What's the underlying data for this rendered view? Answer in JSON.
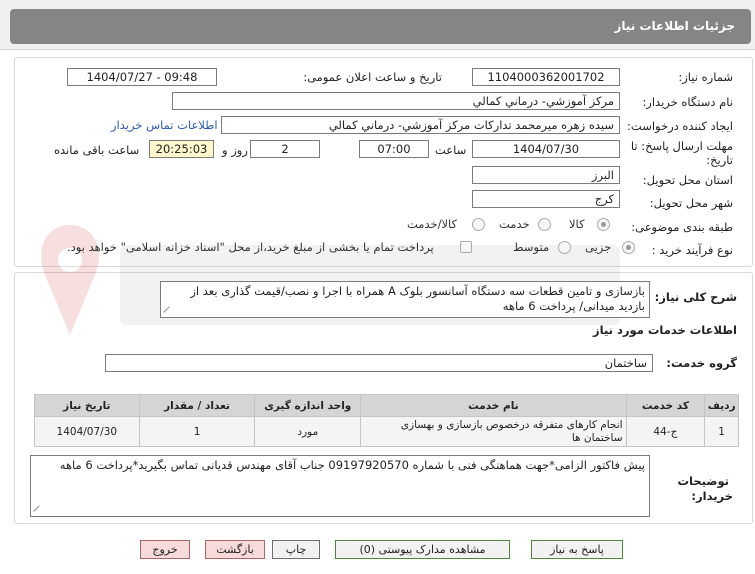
{
  "header": {
    "title": "جزئیات اطلاعات نیاز"
  },
  "form": {
    "need_number_label": "شماره نیاز:",
    "need_number": "1104000362001702",
    "announce_label": "تاریخ و ساعت اعلان عمومی:",
    "announce_value": "1404/07/27 - 09:48",
    "buyer_label": "نام دستگاه خریدار:",
    "buyer_value": "مرکز آموزشي- درماني كمالي",
    "creator_label": "ایجاد کننده درخواست:",
    "creator_value": "سیده زهره میرمحمد تدارکات مرکز آموزشي- درماني كمالي",
    "contact_link": "اطلاعات تماس خریدار",
    "deadline_label_1": "مهلت ارسال پاسخ: تا",
    "deadline_label_2": "تاریخ:",
    "deadline_date": "1404/07/30",
    "time_label": "ساعت",
    "deadline_time": "07:00",
    "days_value": "2",
    "days_label": "روز و",
    "remaining_time": "20:25:03",
    "remaining_label": "ساعت باقی مانده",
    "province_label": "استان محل تحویل:",
    "province_value": "البرز",
    "city_label": "شهر محل تحویل:",
    "city_value": "کرج",
    "category_label": "طبقه بندی موضوعی:",
    "category_options": [
      "کالا",
      "خدمت",
      "کالا/خدمت"
    ],
    "process_label": "نوع فرآیند خرید :",
    "process_options": [
      "جزیی",
      "متوسط"
    ],
    "payment_note": "پرداخت تمام یا بخشی از مبلغ خرید،از محل \"اسناد خزانه اسلامی\" خواهد بود."
  },
  "details": {
    "summary_label": "شرح کلی نیاز:",
    "summary_text": "بازسازی و تامین قطعات سه دستگاه آسانسور بلوک A همراه با اجرا و نصب/قیمت گذاری بعد از بازدید میدانی/ پرداخت 6 ماهه",
    "services_title": "اطلاعات خدمات مورد نیاز",
    "group_label": "گروه خدمت:",
    "group_value": "ساختمان",
    "table": {
      "headers": [
        "ردیف",
        "کد خدمت",
        "نام خدمت",
        "واحد اندازه گیری",
        "تعداد / مقدار",
        "تاریخ نیاز"
      ],
      "rows": [
        [
          "1",
          "ج-44",
          "انجام کارهای متفرقه درخصوص بازسازی و بهسازی ساختمان ها",
          "مورد",
          "1",
          "1404/07/30"
        ]
      ]
    },
    "notes_label_1": "توضیحات",
    "notes_label_2": "خریدار:",
    "notes_text": "پیش فاکتور الزامی*جهت هماهنگی فنی با شماره 09197920570 جناب آقای مهندس قدیانی تماس بگیرید*پرداخت 6 ماهه"
  },
  "buttons": {
    "respond": "پاسخ به نیاز",
    "attachments": "مشاهده مدارک پیوستی (0)",
    "print": "چاپ",
    "back": "بازگشت",
    "exit": "خروج"
  }
}
